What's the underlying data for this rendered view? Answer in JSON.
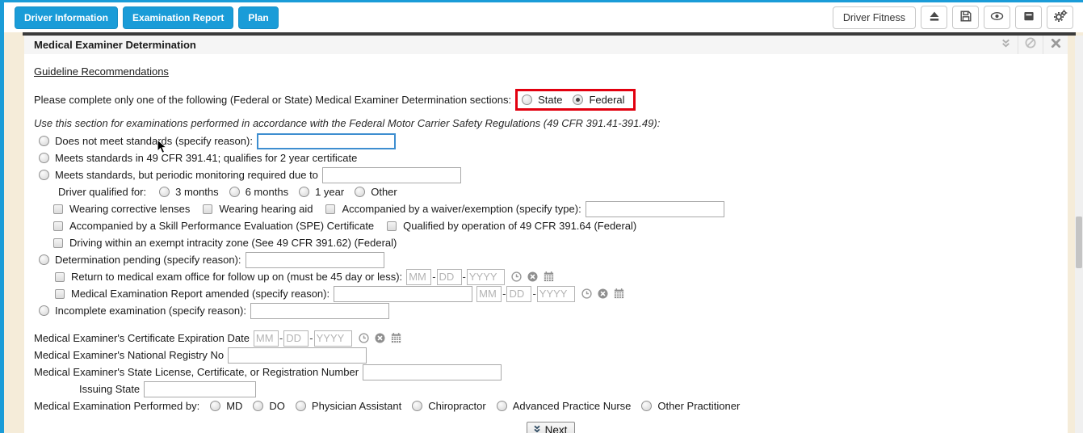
{
  "colors": {
    "accent_blue": "#1a9cd8",
    "highlight_red": "#e2000f"
  },
  "toolbar": {
    "tabs": [
      {
        "label": "Driver Information"
      },
      {
        "label": "Examination Report"
      },
      {
        "label": "Plan"
      }
    ],
    "driver_fitness_label": "Driver Fitness",
    "icon_buttons": [
      "eject-icon",
      "save-icon",
      "eye-icon",
      "archive-icon",
      "gears-icon"
    ]
  },
  "panel": {
    "title": "Medical Examiner Determination",
    "guideline_link": "Guideline Recommendations",
    "intro_text": "Please complete only one of the following (Federal or State) Medical Examiner Determination sections:",
    "jurisdiction": {
      "state_label": "State",
      "federal_label": "Federal",
      "selected": "Federal"
    },
    "federal_note": "Use this section for examinations performed in accordance with the Federal Motor Carrier Safety Regulations (49 CFR 391.41-391.49):"
  },
  "determination": {
    "does_not_meet": "Does not meet standards (specify reason):",
    "meets_standards": "Meets standards in 49 CFR 391.41; qualifies for 2 year certificate",
    "periodic_monitoring": "Meets standards, but periodic monitoring required due to",
    "driver_qualified_label": "Driver qualified for:",
    "qualified_options": [
      "3 months",
      "6 months",
      "1 year",
      "Other"
    ],
    "corrective_lenses": "Wearing corrective lenses",
    "hearing_aid": "Wearing hearing aid",
    "waiver_exemption": "Accompanied by a waiver/exemption (specify type):",
    "spe_certificate": "Accompanied by a Skill Performance Evaluation (SPE) Certificate",
    "qualified_391_64": "Qualified by operation of 49 CFR 391.64 (Federal)",
    "intracity_zone": "Driving within an exempt intracity zone (See 49 CFR 391.62) (Federal)",
    "pending": "Determination pending (specify reason):",
    "return_followup": "Return to medical exam office for follow up on (must be 45 day or less):",
    "report_amended": "Medical Examination Report amended (specify reason):",
    "incomplete": "Incomplete examination (specify reason):"
  },
  "examiner": {
    "cert_expiration": "Medical Examiner's Certificate Expiration Date",
    "national_registry": "Medical Examiner's National Registry No",
    "state_license": "Medical Examiner's State License, Certificate, or Registration Number",
    "issuing_state": "Issuing State",
    "performed_by": "Medical Examination Performed by:",
    "performed_by_options": [
      "MD",
      "DO",
      "Physician Assistant",
      "Chiropractor",
      "Advanced Practice Nurse",
      "Other Practitioner"
    ]
  },
  "date_placeholders": {
    "mm": "MM",
    "dd": "DD",
    "yyyy": "YYYY",
    "sep": "-"
  },
  "footer": {
    "next_label": "Next"
  }
}
